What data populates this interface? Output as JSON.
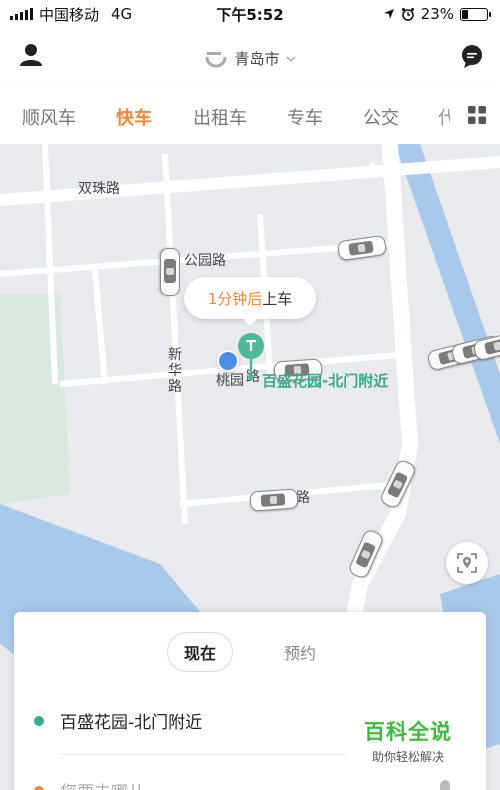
{
  "status_bar": {
    "carrier": "中国移动",
    "network": "4G",
    "time": "下午5:52",
    "battery_percent": "23%",
    "battery_level": 0.23
  },
  "header": {
    "city": "青岛市",
    "icons": [
      "user-icon",
      "logo-icon",
      "chevron-down-icon",
      "chat-icon"
    ]
  },
  "tabs": [
    {
      "label": "顺风车",
      "active": false
    },
    {
      "label": "快车",
      "active": true
    },
    {
      "label": "出租车",
      "active": false
    },
    {
      "label": "专车",
      "active": false
    },
    {
      "label": "公交",
      "active": false
    },
    {
      "label": "代",
      "active": false
    }
  ],
  "map": {
    "roads": [
      "双珠路",
      "公园路",
      "新",
      "华",
      "路",
      "桃园",
      "路",
      "路"
    ],
    "bubble": {
      "eta": "1分钟后",
      "action": "上车"
    },
    "pickup_label": "百盛花园-北门附近",
    "colors": {
      "pin": "#4fb89a",
      "water": "#a9c9ec",
      "green": "#d9e8df",
      "accent": "#f5873c"
    }
  },
  "card": {
    "segments": {
      "now": "现在",
      "reserve": "预约"
    },
    "from": "百盛花园-北门附近",
    "to_placeholder": "您要去哪儿"
  },
  "watermark": {
    "title": "百科全说",
    "subtitle": "助你轻松解决"
  }
}
